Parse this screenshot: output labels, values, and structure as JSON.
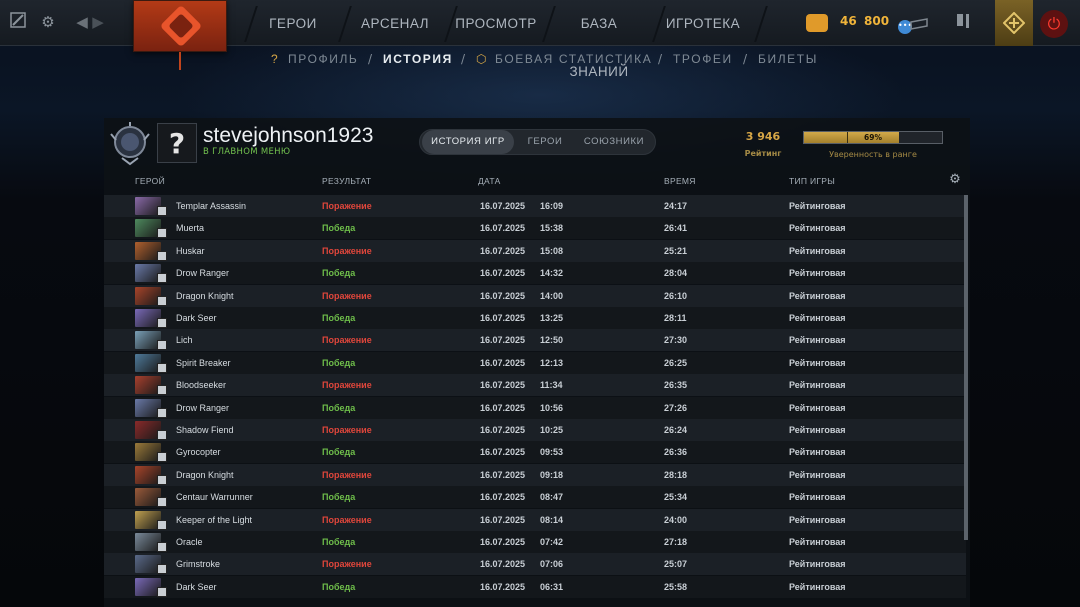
{
  "topbar": {
    "nav": [
      "ГЕРОИ",
      "АРСЕНАЛ",
      "ПРОСМОТР",
      "БАЗА ЗНАНИЙ",
      "ИГРОТЕКА"
    ],
    "coins_primary": "46",
    "coins_secondary": "800",
    "chat_badge": "•••"
  },
  "subnav": {
    "items": [
      "ПРОФИЛЬ",
      "ИСТОРИЯ",
      "БОЕВАЯ СТАТИСТИКА",
      "ТРОФЕИ",
      "БИЛЕТЫ"
    ],
    "active": "ИСТОРИЯ",
    "separator": "/"
  },
  "profile": {
    "avatar_glyph": "?",
    "username": "stevejohnson1923",
    "status": "В ГЛАВНОМ МЕНЮ",
    "tabs": [
      "ИСТОРИЯ ИГР",
      "ГЕРОИ",
      "СОЮЗНИКИ"
    ],
    "rating_value": "3 946",
    "rating_label": "Рейтинг",
    "confidence_value": "69%",
    "confidence_fraction": 0.69,
    "confidence_label": "Уверенность в ранге"
  },
  "table": {
    "headers": {
      "hero": "ГЕРОЙ",
      "result": "РЕЗУЛЬТАТ",
      "date": "ДАТА",
      "duration": "ВРЕМЯ",
      "mode": "ТИП ИГРЫ"
    },
    "rows": [
      {
        "hero": "Templar Assassin",
        "result": "Поражение",
        "win": false,
        "date": "16.07.2025",
        "time": "16:09",
        "duration": "24:17",
        "mode": "Рейтинговая",
        "color": "#8a6aa8"
      },
      {
        "hero": "Muerta",
        "result": "Победа",
        "win": true,
        "date": "16.07.2025",
        "time": "15:38",
        "duration": "26:41",
        "mode": "Рейтинговая",
        "color": "#4e8a5e"
      },
      {
        "hero": "Huskar",
        "result": "Поражение",
        "win": false,
        "date": "16.07.2025",
        "time": "15:08",
        "duration": "25:21",
        "mode": "Рейтинговая",
        "color": "#b0602e"
      },
      {
        "hero": "Drow Ranger",
        "result": "Победа",
        "win": true,
        "date": "16.07.2025",
        "time": "14:32",
        "duration": "28:04",
        "mode": "Рейтинговая",
        "color": "#6a7aa8"
      },
      {
        "hero": "Dragon Knight",
        "result": "Поражение",
        "win": false,
        "date": "16.07.2025",
        "time": "14:00",
        "duration": "26:10",
        "mode": "Рейтинговая",
        "color": "#a8442a"
      },
      {
        "hero": "Dark Seer",
        "result": "Победа",
        "win": true,
        "date": "16.07.2025",
        "time": "13:25",
        "duration": "28:11",
        "mode": "Рейтинговая",
        "color": "#7a6ab8"
      },
      {
        "hero": "Lich",
        "result": "Поражение",
        "win": false,
        "date": "16.07.2025",
        "time": "12:50",
        "duration": "27:30",
        "mode": "Рейтинговая",
        "color": "#7aa0b8"
      },
      {
        "hero": "Spirit Breaker",
        "result": "Победа",
        "win": true,
        "date": "16.07.2025",
        "time": "12:13",
        "duration": "26:25",
        "mode": "Рейтинговая",
        "color": "#4e7a9a"
      },
      {
        "hero": "Bloodseeker",
        "result": "Поражение",
        "win": false,
        "date": "16.07.2025",
        "time": "11:34",
        "duration": "26:35",
        "mode": "Рейтинговая",
        "color": "#a8402e"
      },
      {
        "hero": "Drow Ranger",
        "result": "Победа",
        "win": true,
        "date": "16.07.2025",
        "time": "10:56",
        "duration": "27:26",
        "mode": "Рейтинговая",
        "color": "#6a7aa8"
      },
      {
        "hero": "Shadow Fiend",
        "result": "Поражение",
        "win": false,
        "date": "16.07.2025",
        "time": "10:25",
        "duration": "26:24",
        "mode": "Рейтинговая",
        "color": "#8a2a2a"
      },
      {
        "hero": "Gyrocopter",
        "result": "Победа",
        "win": true,
        "date": "16.07.2025",
        "time": "09:53",
        "duration": "26:36",
        "mode": "Рейтинговая",
        "color": "#9a7a3a"
      },
      {
        "hero": "Dragon Knight",
        "result": "Поражение",
        "win": false,
        "date": "16.07.2025",
        "time": "09:18",
        "duration": "28:18",
        "mode": "Рейтинговая",
        "color": "#a8442a"
      },
      {
        "hero": "Centaur Warrunner",
        "result": "Победа",
        "win": true,
        "date": "16.07.2025",
        "time": "08:47",
        "duration": "25:34",
        "mode": "Рейтинговая",
        "color": "#9a5a3a"
      },
      {
        "hero": "Keeper of the Light",
        "result": "Поражение",
        "win": false,
        "date": "16.07.2025",
        "time": "08:14",
        "duration": "24:00",
        "mode": "Рейтинговая",
        "color": "#c0a050"
      },
      {
        "hero": "Oracle",
        "result": "Победа",
        "win": true,
        "date": "16.07.2025",
        "time": "07:42",
        "duration": "27:18",
        "mode": "Рейтинговая",
        "color": "#7a8a9a"
      },
      {
        "hero": "Grimstroke",
        "result": "Поражение",
        "win": false,
        "date": "16.07.2025",
        "time": "07:06",
        "duration": "25:07",
        "mode": "Рейтинговая",
        "color": "#5a6a8a"
      },
      {
        "hero": "Dark Seer",
        "result": "Победа",
        "win": true,
        "date": "16.07.2025",
        "time": "06:31",
        "duration": "25:58",
        "mode": "Рейтинговая",
        "color": "#7a6ab8"
      }
    ]
  },
  "colors": {
    "loss": "#e0463b",
    "win": "#6ebd4a",
    "rating_gold": "#d6a646",
    "status_green": "#73c24f"
  }
}
